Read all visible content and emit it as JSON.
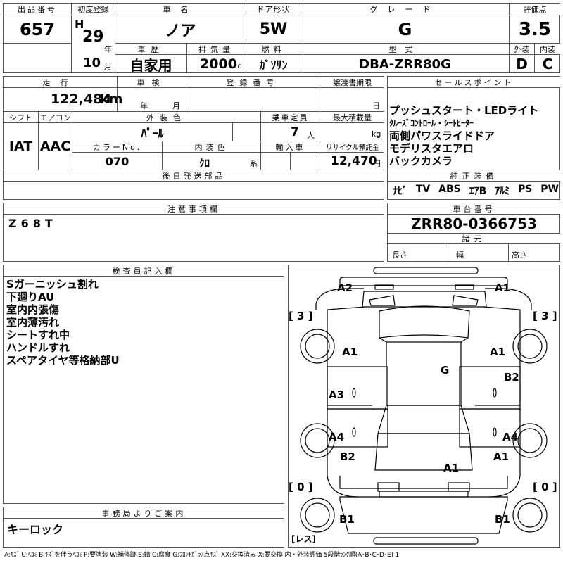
{
  "lot": {
    "label": "出品番号",
    "value": "657"
  },
  "first_reg": {
    "label": "初度登録",
    "era": "H",
    "year": "29",
    "year_unit": "年",
    "month": "10",
    "month_unit": "月"
  },
  "car_name": {
    "label": "車名",
    "value": "ノア"
  },
  "door": {
    "label": "ドア形状",
    "value": "5W"
  },
  "grade": {
    "label": "グレード",
    "value": "G"
  },
  "score": {
    "label": "評価点",
    "value": "3.5"
  },
  "history": {
    "label": "車歴",
    "value": "自家用"
  },
  "displacement": {
    "label": "排気量",
    "value": "2000",
    "unit": "cc"
  },
  "fuel": {
    "label": "燃料",
    "value": "ｶﾞｿﾘﾝ"
  },
  "model": {
    "label": "型式",
    "value": "DBA-ZRR80G"
  },
  "exterior": {
    "label": "外装",
    "value": "D"
  },
  "interior": {
    "label": "内装",
    "value": "C"
  },
  "mileage": {
    "label": "走行",
    "value": "122,484",
    "unit": "km"
  },
  "inspection": {
    "label": "車検",
    "year_unit": "年",
    "month_unit": "月"
  },
  "registration": {
    "label": "登録番号"
  },
  "transfer_deadline": {
    "label": "譲渡書期限",
    "day_unit": "日"
  },
  "shift": {
    "label": "シフト",
    "value": "IAT"
  },
  "aircon": {
    "label": "エアコン",
    "value": "AAC"
  },
  "ext_color": {
    "label": "外装色",
    "value": "ﾊﾟｰﾙ"
  },
  "capacity": {
    "label": "乗車定員",
    "value": "7",
    "unit": "人"
  },
  "max_load": {
    "label": "最大積載量",
    "unit": "kg"
  },
  "color_no": {
    "label": "カラーNo.",
    "value": "070"
  },
  "int_color": {
    "label": "内装色",
    "value": "ｸﾛ",
    "unit": "系"
  },
  "import": {
    "label": "輸入車"
  },
  "recycle": {
    "label": "リサイクル預託金",
    "value": "12,470",
    "unit": "円"
  },
  "sales_points": {
    "label": "セールスポイント",
    "lines": [
      "プッシュスタート・LEDライト",
      "ｸﾙｰｽﾞｺﾝﾄﾛｰﾙ・ｼｰﾄﾋｰﾀｰ",
      "両側パワスライドドア",
      "モデリスタエアロ",
      "バックカメラ"
    ]
  },
  "later_parts": {
    "label": "後日発送部品"
  },
  "equipment": {
    "label": "純正装備",
    "items": [
      "ﾅﾋﾞ",
      "TV",
      "ABS",
      "ｴｱB",
      "ｱﾙﾐ",
      "PS",
      "PW"
    ]
  },
  "notes": {
    "label": "注意事項欄",
    "value": "Z68T"
  },
  "chassis": {
    "label": "車台番号",
    "value": "ZRR80-0366753"
  },
  "specs": {
    "label": "諸元",
    "length": "長さ",
    "width": "幅",
    "height": "高さ"
  },
  "inspector": {
    "label": "検査員記入欄",
    "lines": [
      "Sガーニッシュ割れ",
      "下廻りAU",
      "室内内張傷",
      "室内薄汚れ",
      "シートすれ中",
      "ハンドルすれ",
      "スペアタイヤ等格納部U"
    ]
  },
  "office": {
    "label": "事務局よりご案内",
    "value": "キーロック"
  },
  "diagram": {
    "tires": {
      "fl": "[ 3 ]",
      "fr": "[ 3 ]",
      "rl": "[ 0 ]",
      "rr": "[ 0 ]",
      "spare": "[レス]"
    },
    "marks": [
      "A2",
      "A1",
      "A1",
      "A1",
      "G",
      "B2",
      "A3",
      "A4",
      "A4",
      "B2",
      "A1",
      "A1",
      "B1",
      "B1"
    ]
  },
  "legend": "A:ｷｽﾞ U:ﾍｺﾐ B:ｷｽﾞを伴うﾍｺﾐ P:要塗装 W:補修跡 S:錆 C:腐食 G:ﾌﾛﾝﾄｶﾞﾗｽ点ｷｽﾞ XX:交換済み X:要交換 内・外装評価 5段階ﾗﾝｸ順(A･B･C･D･E) 1"
}
